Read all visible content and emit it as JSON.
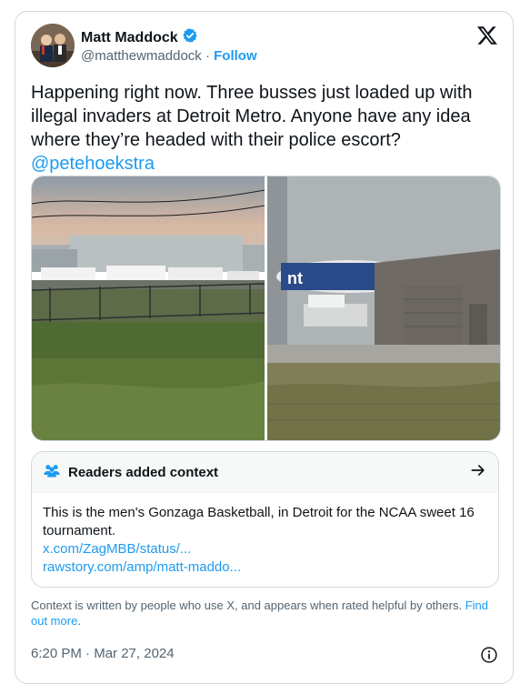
{
  "author": {
    "name": "Matt Maddock",
    "handle": "@matthewmaddock",
    "separator": "·",
    "follow_label": "Follow"
  },
  "tweet": {
    "text": "Happening right now. Three busses just loaded up with illegal invaders at Detroit Metro. Anyone have any idea where they’re headed with their police escort?",
    "mention": "@petehoekstra"
  },
  "context_note": {
    "title": "Readers added context",
    "body": "This is the men's Gonzaga Basketball, in Detroit for the NCAA sweet 16 tournament.",
    "links": [
      "x.com/ZagMBB/status/...",
      "rawstory.com/amp/matt-maddo..."
    ]
  },
  "footnote": {
    "text": "Context is written by people who use X, and appears when rated helpful by others.",
    "find_out_more": "Find out more",
    "period": "."
  },
  "timestamp": {
    "time": "6:20 PM",
    "separator": "·",
    "date": "Mar 27, 2024"
  },
  "media": {
    "image2_text": "nt"
  },
  "icons": {
    "verified": "verified-badge-icon",
    "logo": "x-logo-icon",
    "people": "people-icon",
    "arrow": "arrow-right-icon",
    "info": "info-icon"
  },
  "colors": {
    "accent": "#1d9bf0",
    "text": "#0f1419",
    "muted": "#536471",
    "border": "#cfd9de"
  }
}
